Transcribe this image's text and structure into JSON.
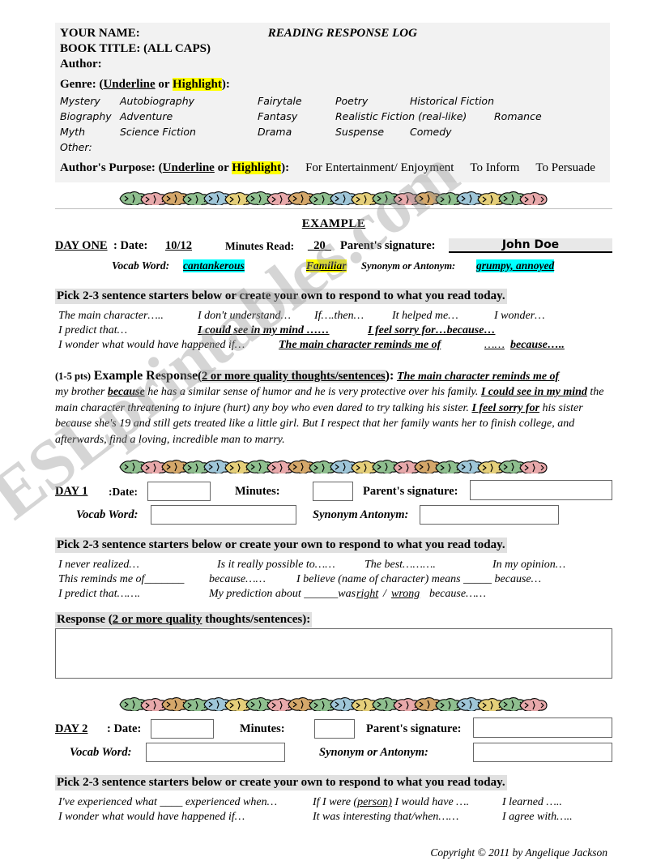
{
  "header": {
    "your_name_label": "YOUR NAME:",
    "doc_title": "READING RESPONSE LOG",
    "book_title_label": "BOOK TITLE: (ALL CAPS)",
    "author_label": "Author:",
    "genre_label": "Genre: (",
    "genre_underline": "Underline",
    "genre_or": " or ",
    "genre_highlight": "Highlight",
    "genre_close": "):",
    "genres_row1": [
      "Mystery",
      "Autobiography",
      "Fairytale",
      "Poetry",
      "Historical Fiction"
    ],
    "genres_row2": [
      "Biography",
      "Adventure",
      "Fantasy",
      "Realistic Fiction (real-like)",
      "Romance"
    ],
    "genres_row3": [
      "Myth",
      "Science Fiction",
      "Drama",
      "Suspense",
      "Comedy"
    ],
    "other_label": "Other:",
    "purpose_label": "Author's Purpose: (",
    "purpose_underline": "Underline",
    "purpose_or": " or ",
    "purpose_highlight": "Highlight",
    "purpose_close": "):",
    "purposes": [
      "For Entertainment/ Enjoyment",
      "To Inform",
      "To Persuade"
    ]
  },
  "example": {
    "title": "EXAMPLE",
    "day_label": "DAY ONE",
    "date_label": ":  Date: ",
    "date_value": "10/12",
    "minutes_label": "Minutes Read:",
    "minutes_value": "_20_",
    "signature_label": "Parent's signature:",
    "signature_value": "John Doe",
    "vocab_label": "Vocab Word:",
    "vocab_value": "cantankerous",
    "familiar_label": "Familiar",
    "syn_ant_label": "Synonym or Antonym:",
    "syn_ant_value": "grumpy,   annoyed"
  },
  "pick_bar_text": "Pick 2-3 sentence starters below or create your own to respond to what you read today.",
  "starters_example": {
    "row1": [
      "The main character…..",
      "I don't understand…",
      "If….then…",
      "It helped me…",
      "I wonder…"
    ],
    "row2_plain": "I predict that…",
    "row2_b1": "I could see in my mind ……",
    "row2_b2": "I feel sorry for…because…",
    "row3_plain": "I wonder what would have happened if…",
    "row3_b1": "The main character reminds me of",
    "row3_mid": "……",
    "row3_b2": "because….."
  },
  "example_response": {
    "points": "(1-5 pts)",
    "title": "Example Response",
    "criteria_open": "(",
    "criteria": "2 or more quality thoughts/sentences",
    "criteria_close": "):",
    "lead": "The main character reminds me of",
    "body_1": " my brother ",
    "body_b1": "because",
    "body_2": " he has a similar sense of humor and he is very protective over his family. ",
    "body_b2": "I could see in my mind",
    "body_3": " the main character threatening to injure (hurt) any boy who even dared to try talking his sister. ",
    "body_b3": "I feel sorry for",
    "body_4": " his sister because she's 19 and still gets treated like a little girl. But I respect that her family wants her to finish college, and afterwards, find a loving, incredible man to marry."
  },
  "day1": {
    "day_label": "DAY 1",
    "date_label": ":Date:",
    "minutes_label": "Minutes:",
    "signature_label": "Parent's signature:",
    "vocab_label": "Vocab Word:",
    "syn_ant_label": "Synonym  Antonym:",
    "response_label_plain": "Response (",
    "response_label_u": "2 or more quality",
    "response_label_rest": " thoughts/sentences):"
  },
  "starters_day1": {
    "row1": [
      "I never realized…",
      "Is it really possible to……",
      "The best……….",
      "In my opinion…"
    ],
    "row2_a": "This reminds me of_______",
    "row2_b": "because……",
    "row2_c": "I believe (name of character) means _____ because…",
    "row3_a": "I predict that…….",
    "row3_b": "My prediction about ______was ",
    "row3_right": "right",
    "row3_slash": " / ",
    "row3_wrong": "wrong",
    "row3_tail": " because……"
  },
  "day2": {
    "day_label": "DAY 2",
    "date_label": ": Date:",
    "minutes_label": "Minutes:",
    "signature_label": "Parent's signature:",
    "vocab_label": "Vocab Word:",
    "syn_ant_label": "Synonym or  Antonym:"
  },
  "starters_day2": {
    "row1_a": "I've experienced what ____ experienced when…",
    "row1_b_pre": "If I were ",
    "row1_b_u": "(person)",
    "row1_b_post": " I would have ….",
    "row1_c": "I learned …..",
    "row2_a": "I wonder what would have happened if…",
    "row2_b": "It was interesting that/when……",
    "row2_c": "I agree with….."
  },
  "copyright": "Copyright © 2011 by Angelique Jackson",
  "watermark": "ESLprintables.com",
  "colors": {
    "highlight_yellow": "#ffff00",
    "highlight_cyan": "#00ffff",
    "header_shade": "#f2f2f2",
    "bar_shade": "#e0e0e0",
    "box_border": "#666666"
  }
}
